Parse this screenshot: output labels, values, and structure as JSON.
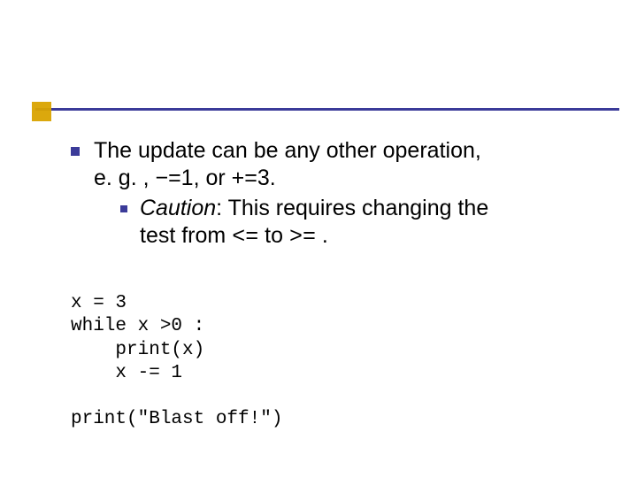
{
  "bullets": {
    "main": {
      "line1": "The update can be any other operation,",
      "line2": "e. g. , −=1, or +=3."
    },
    "sub": {
      "caution_word": "Caution",
      "after_caution": ": This requires changing the",
      "line2_prefix": "test from ",
      "op1": "<=",
      "mid": "  to ",
      "op2": ">=",
      "line2_suffix": " ."
    }
  },
  "code": {
    "l1": "x = 3",
    "l2": "while x >0 :",
    "l3": "    print(x)",
    "l4": "    x -= 1",
    "l5": "",
    "l6": "print(\"Blast off!\")"
  }
}
